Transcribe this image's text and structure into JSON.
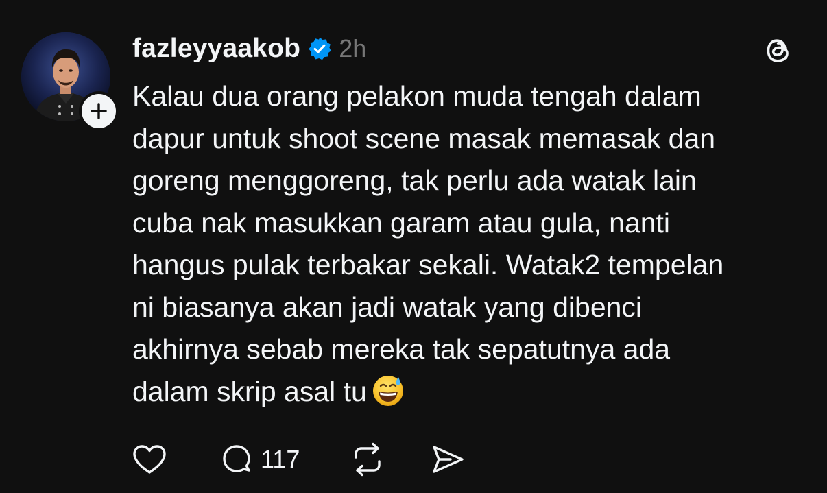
{
  "post": {
    "username": "fazleyyaakob",
    "time": "2h",
    "text": "Kalau dua orang pelakon muda tengah dalam\ndapur untuk shoot scene masak memasak dan\ngoreng menggoreng, tak perlu ada watak lain\ncuba nak masukkan garam atau gula, nanti\nhangus pulak terbakar sekali. Watak2 tempelan\nni biasanya akan jadi watak yang dibenci\nakhirnya sebab mereka tak sepatutnya ada\ndalam skrip asal tu",
    "emoji": "grinning-face-with-sweat",
    "verified": true
  },
  "actions": {
    "reply_count": "117"
  },
  "icons": {
    "follow": "plus-icon",
    "verified": "verified-badge-icon",
    "logo": "threads-logo-icon",
    "like": "heart-icon",
    "reply": "comment-bubble-icon",
    "repost": "repost-icon",
    "share": "send-icon"
  },
  "colors": {
    "background": "#101010",
    "text": "#f3f5f7",
    "muted": "#777777",
    "verified": "#0095f6"
  }
}
